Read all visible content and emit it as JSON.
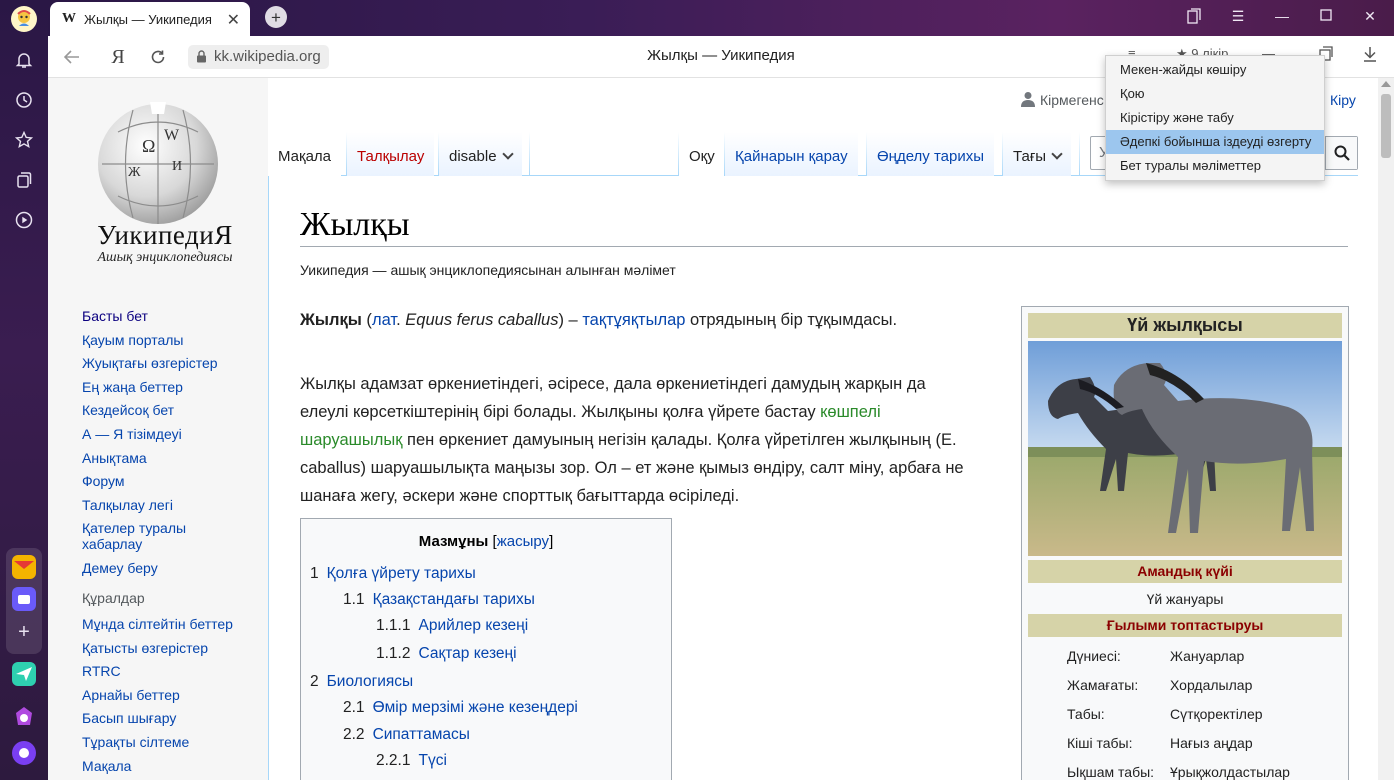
{
  "browser": {
    "tab": {
      "favicon": "W",
      "title": "Жылқы — Уикипедия"
    },
    "address": {
      "domain": "kk.wikipedia.org",
      "page_title": "Жылқы — Уикипедия",
      "likes": "★ 9 лікір"
    },
    "context_menu": {
      "items": [
        "Мекен-жайды көшіру",
        "Қою",
        "Кірістіру және табу",
        "Әдепкі бойынша іздеуді өзгерту",
        "Бет туралы мәліметтер"
      ],
      "highlighted_index": 3
    }
  },
  "sidebar_icons": [
    "profile-avatar",
    "bell-icon",
    "history-icon",
    "star-icon",
    "collections-icon",
    "play-icon",
    "mail-app",
    "messenger-app",
    "add-app",
    "send-app",
    "alice-app",
    "assistant-app"
  ],
  "wiki": {
    "logo_word": "УикипедиЯ",
    "logo_sub": "Ашық энциклопедиясы",
    "user_label": "Кірмегенс",
    "login_label": "Кіру",
    "nav": [
      "Басты бет",
      "Қауым порталы",
      "Жуықтағы өзгерістер",
      "Ең жаңа беттер",
      "Кездейсоқ бет",
      "А — Я тізімдеуі",
      "Анықтама",
      "Форум",
      "Талқылау легі",
      "Қателер туралы хабарлау",
      "Демеу беру"
    ],
    "tools_heading": "Құралдар",
    "tools": [
      "Мұнда сілтейтін беттер",
      "Қатысты өзгерістер",
      "RTRC",
      "Арнайы беттер",
      "Басып шығару",
      "Тұрақты сілтеме",
      "Мақала"
    ],
    "tabs": {
      "article": "Мақала",
      "talk": "Талқылау",
      "variant": "disable",
      "read": "Оқу",
      "view_source": "Қайнарын қарау",
      "history": "Өңделу тарихы",
      "more": "Тағы",
      "search_placeholder": "У"
    },
    "article": {
      "title": "Жылқы",
      "tagline": "Уикипедия — ашық энциклопедиясынан алынған мәлімет",
      "lead": {
        "bold": "Жылқы",
        "open": " (",
        "lat": "лат",
        "dot": ". ",
        "latin_name": "Equus ferus caballus",
        "close": ") – ",
        "link": "тақтұяқтылар",
        "rest": " отрядының бір тұқымдасы."
      },
      "para2": {
        "part1": "Жылқы адамзат өркениетіндегі, әсіресе, дала өркениетіндегі дамудың жарқын да",
        "part2": "елеулі көрсеткіштерінің бірі болады. Жылқыны қолға үйрете бастау ",
        "link1": "көшпелі",
        "link2": "шаруашылық",
        "part3": " пен өркениет дамуының негізін қалады. Қолға үйретілген жылқының (E.",
        "part4": "caballus) шаруашылықта маңызы зор. Ол – ет және қымыз өндіру, салт міну, арбаға не",
        "part5": "шанаға жегу, әскери және спорттық бағыттарда өсіріледі."
      }
    },
    "toc": {
      "title": "Мазмұны",
      "toggle_open": " [",
      "toggle": "жасыру",
      "toggle_close": "]",
      "items": [
        {
          "num": "1",
          "text": "Қолға үйрету тарихы"
        },
        {
          "num": "1.1",
          "text": "Қазақстандағы тарихы"
        },
        {
          "num": "1.1.1",
          "text": "Арийлер кезеңі"
        },
        {
          "num": "1.1.2",
          "text": "Сақтар кезеңі"
        },
        {
          "num": "2",
          "text": "Биологиясы"
        },
        {
          "num": "2.1",
          "text": "Өмір мерзімі және кезеңдері"
        },
        {
          "num": "2.2",
          "text": "Сипаттамасы"
        },
        {
          "num": "2.2.1",
          "text": "Түсі"
        }
      ]
    },
    "infobox": {
      "title": "Үй жылқысы",
      "status_heading": "Амандық күйі",
      "status": "Үй жануары",
      "taxonomy_heading": "Ғылыми топтастыруы",
      "rows": [
        {
          "label": "Дүниесі:",
          "value": "Жануарлар"
        },
        {
          "label": "Жамағаты:",
          "value": "Хордалылар"
        },
        {
          "label": "Табы:",
          "value": "Сүтқоректілер"
        },
        {
          "label": "Кіші табы:",
          "value": "Нағыз аңдар"
        },
        {
          "label": "Ықшам табы:",
          "value": "Ұрықжолдастылар"
        }
      ]
    }
  },
  "colors": {
    "link": "#0645ad",
    "visited_green": "#2a8a2a",
    "talk_red": "#ba0000",
    "infobox_header": "#d6d3a8",
    "menu_highlight": "#9cc6ee"
  }
}
